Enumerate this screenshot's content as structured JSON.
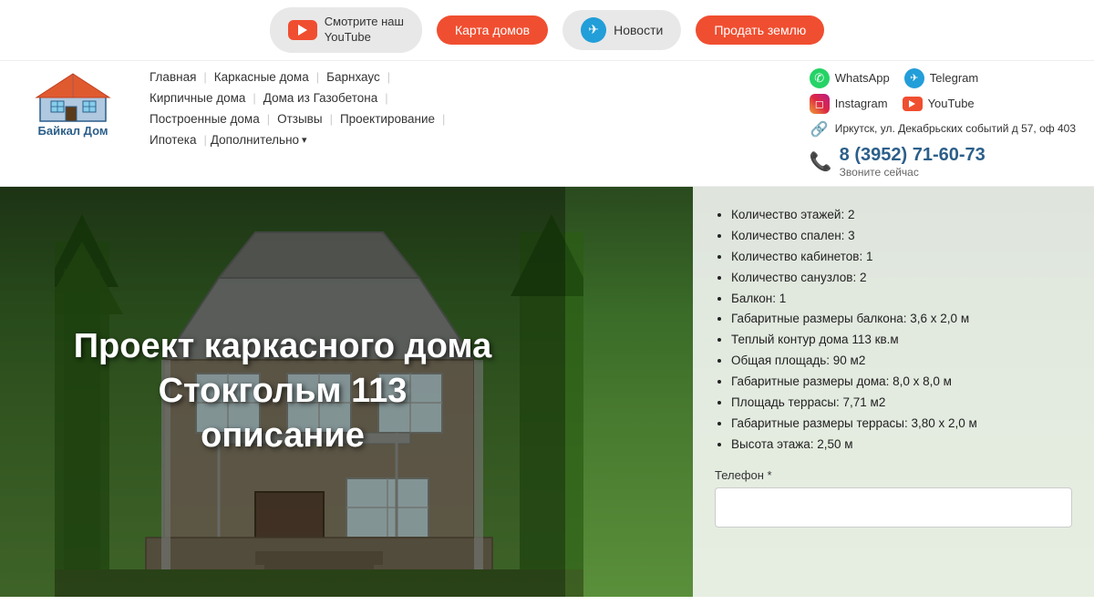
{
  "topbar": {
    "youtube_label": "Смотрите наш\nYouTube",
    "karta_label": "Карта домов",
    "novosti_label": "Новости",
    "prodat_label": "Продать землю"
  },
  "nav": {
    "items": [
      {
        "label": "Главная"
      },
      {
        "label": "Каркасные дома"
      },
      {
        "label": "Барнхаус"
      },
      {
        "label": "Кирпичные дома"
      },
      {
        "label": "Дома из Газобетона"
      },
      {
        "label": "Построенные дома"
      },
      {
        "label": "Отзывы"
      },
      {
        "label": "Проектирование"
      },
      {
        "label": "Ипотека"
      },
      {
        "label": "Дополнительно"
      }
    ]
  },
  "contacts": {
    "whatsapp": "WhatsApp",
    "telegram": "Telegram",
    "instagram": "Instagram",
    "youtube": "YouTube",
    "address": "Иркутск, ул. Декабрьских событий д 57, оф 403",
    "phone": "8 (3952) 71-60-73",
    "phone_label": "Звоните сейчас"
  },
  "hero": {
    "title": "Проект каркасного дома\nСтокгольм 113\nописание"
  },
  "specs": [
    "Количество этажей: 2",
    "Количество спален: 3",
    "Количество кабинетов: 1",
    "Количество санузлов: 2",
    "Балкон: 1",
    "Габаритные размеры балкона:  3,6 х 2,0 м",
    "Теплый контур дома 113 кв.м",
    "Общая площадь: 90 м2",
    "Габаритные размеры дома: 8,0 х 8,0 м",
    "Площадь террасы:  7,71 м2",
    "Габаритные размеры террасы:  3,80 х 2,0 м",
    "Высота этажа: 2,50 м"
  ],
  "form": {
    "phone_label": "Телефон *",
    "phone_placeholder": ""
  },
  "logo": {
    "text": "Байкал Дом"
  }
}
